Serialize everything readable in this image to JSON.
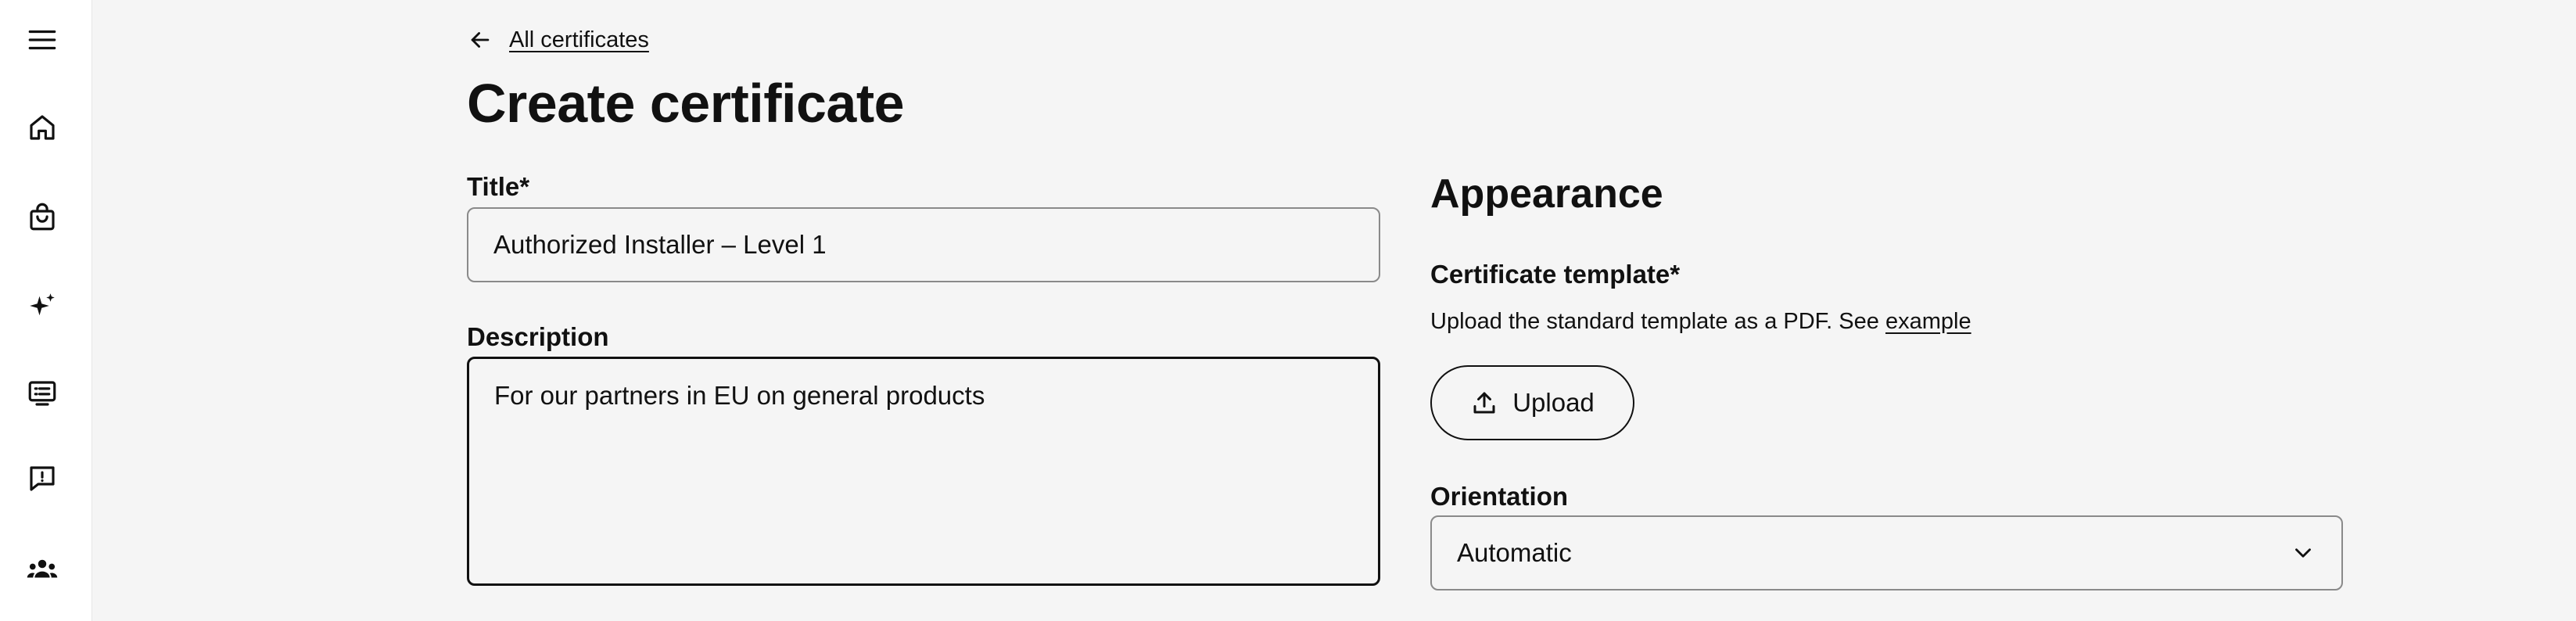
{
  "sidebar": {
    "items": [
      {
        "icon": "menu-icon"
      },
      {
        "icon": "home-icon"
      },
      {
        "icon": "shopping-bag-icon"
      },
      {
        "icon": "sparkles-icon"
      },
      {
        "icon": "certificate-icon"
      },
      {
        "icon": "feedback-icon"
      },
      {
        "icon": "people-icon"
      }
    ]
  },
  "header": {
    "back_link": "All certificates",
    "title": "Create certificate"
  },
  "form": {
    "title_label": "Title*",
    "title_value": "Authorized Installer – Level 1",
    "description_label": "Description",
    "description_value": "For our partners in EU on general products"
  },
  "appearance": {
    "heading": "Appearance",
    "template_label": "Certificate template*",
    "template_help": "Upload the standard template as a PDF. See ",
    "template_help_link": "example",
    "upload_label": "Upload",
    "orientation_label": "Orientation",
    "orientation_value": "Automatic"
  }
}
